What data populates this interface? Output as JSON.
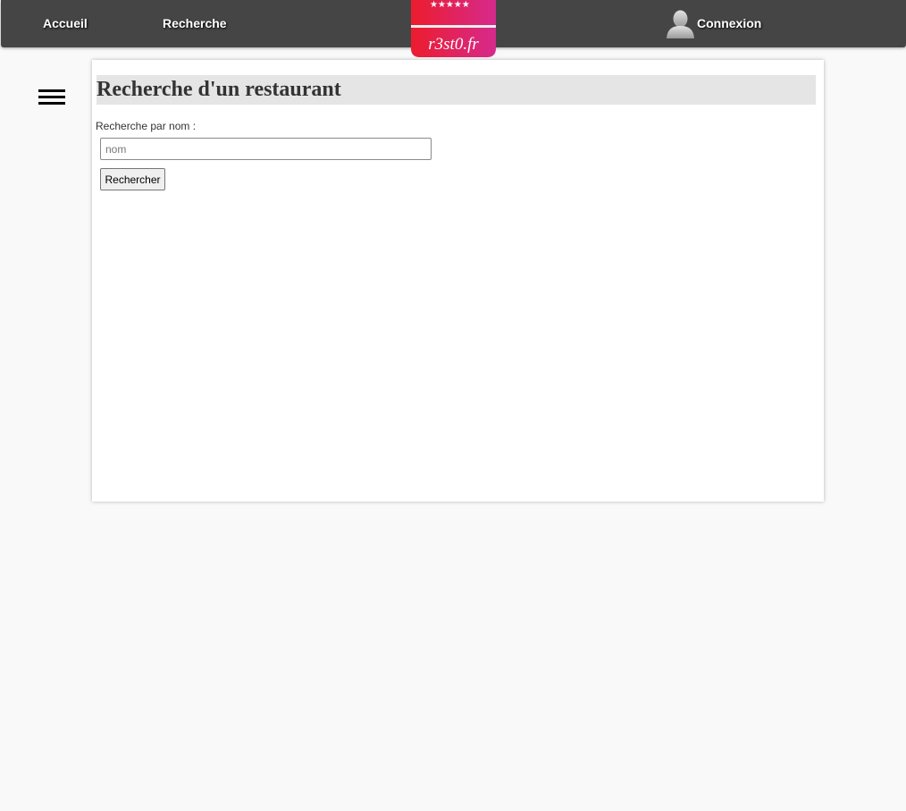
{
  "header": {
    "nav": [
      {
        "label": "Accueil"
      },
      {
        "label": "Recherche"
      }
    ],
    "logo": {
      "text": "r3st0.fr",
      "icon": "burger-logo"
    },
    "login": {
      "label": "Connexion",
      "icon": "user-avatar-icon"
    }
  },
  "sidebar": {
    "menu_icon": "hamburger-menu-icon"
  },
  "main": {
    "title": "Recherche d'un restaurant",
    "search": {
      "label": "Recherche par nom :",
      "placeholder": "nom",
      "value": "",
      "button_label": "Rechercher"
    }
  },
  "colors": {
    "topbar": "#454545",
    "page_background": "#f9f9f9",
    "title_background": "#e5e5e5",
    "logo_gradient_start": "#ec1c2e",
    "logo_gradient_end": "#d62a8c"
  }
}
